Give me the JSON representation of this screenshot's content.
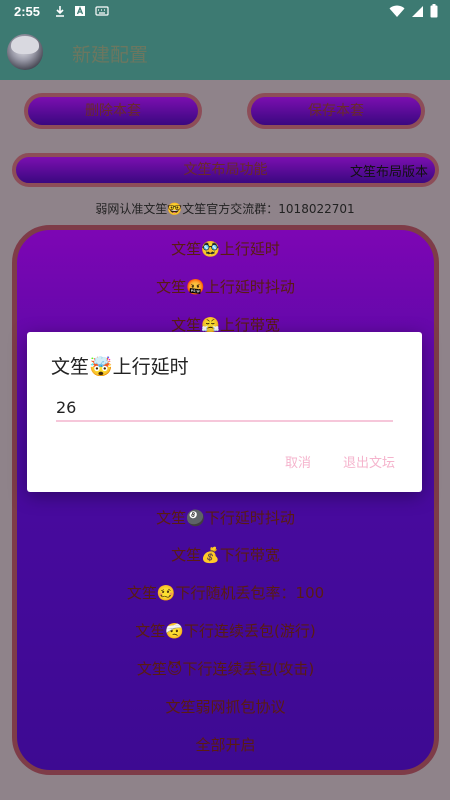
{
  "statusbar": {
    "time": "2:55",
    "icons": [
      "download-icon",
      "a-box-icon",
      "keyboard-icon",
      "wifi-icon",
      "cell-signal-icon",
      "battery-icon"
    ]
  },
  "appbar": {
    "title": "新建配置"
  },
  "buttons": {
    "delete_label": "删除本套",
    "save_label": "保存本套",
    "layout_label": "文笙布局功能"
  },
  "layout_version": "文笙布局版本",
  "notice": "弱网认准文笙🤓文笙官方交流群：1018022701",
  "panel_items": [
    "文笙🥸上行延时",
    "文笙🤬上行延时抖动",
    "文笙😤上行带宽",
    "文笙🎱下行延时抖动",
    "文笙💰下行带宽",
    "文笙🥴下行随机丢包率：100",
    "文笙🤕下行连续丢包(游行)",
    "文笙😈下行连续丢包(攻击)",
    "文笙弱网抓包协议",
    "全部开启"
  ],
  "dialog": {
    "title": "文笙🤯上行延时",
    "value": "26",
    "cancel": "取消",
    "quit": "退出文坛"
  },
  "colors": {
    "header": "#3d7a72",
    "panel_top": "#7d06b4",
    "panel_bottom": "#3d0a92",
    "accent_pink": "#f5b4cd"
  }
}
